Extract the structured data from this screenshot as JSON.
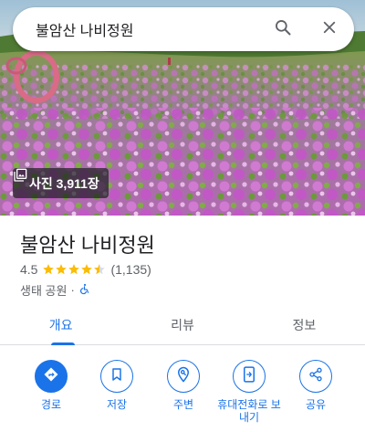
{
  "search": {
    "query": "불암산 나비정원",
    "search_icon": "search-icon",
    "close_icon": "close-icon"
  },
  "hero": {
    "photo_count_label": "사진 3,911장",
    "photo_icon": "photo-gallery-icon"
  },
  "place": {
    "title": "불암산 나비정원",
    "rating": "4.5",
    "stars_filled": 4.5,
    "stars_total": 5,
    "review_count": "(1,135)",
    "category": "생태 공원",
    "separator": "·",
    "accessibility_icon": "wheelchair-icon"
  },
  "tabs": [
    {
      "label": "개요",
      "active": true
    },
    {
      "label": "리뷰",
      "active": false
    },
    {
      "label": "정보",
      "active": false
    }
  ],
  "actions": [
    {
      "label": "경로",
      "icon": "directions-icon"
    },
    {
      "label": "저장",
      "icon": "bookmark-icon"
    },
    {
      "label": "주변",
      "icon": "nearby-icon"
    },
    {
      "label": "휴대전화로 보내기",
      "icon": "send-to-phone-icon"
    },
    {
      "label": "공유",
      "icon": "share-icon"
    }
  ],
  "colors": {
    "accent": "#1a73e8",
    "star": "#fbbc04",
    "text_primary": "#202124",
    "text_secondary": "#5f6368"
  }
}
